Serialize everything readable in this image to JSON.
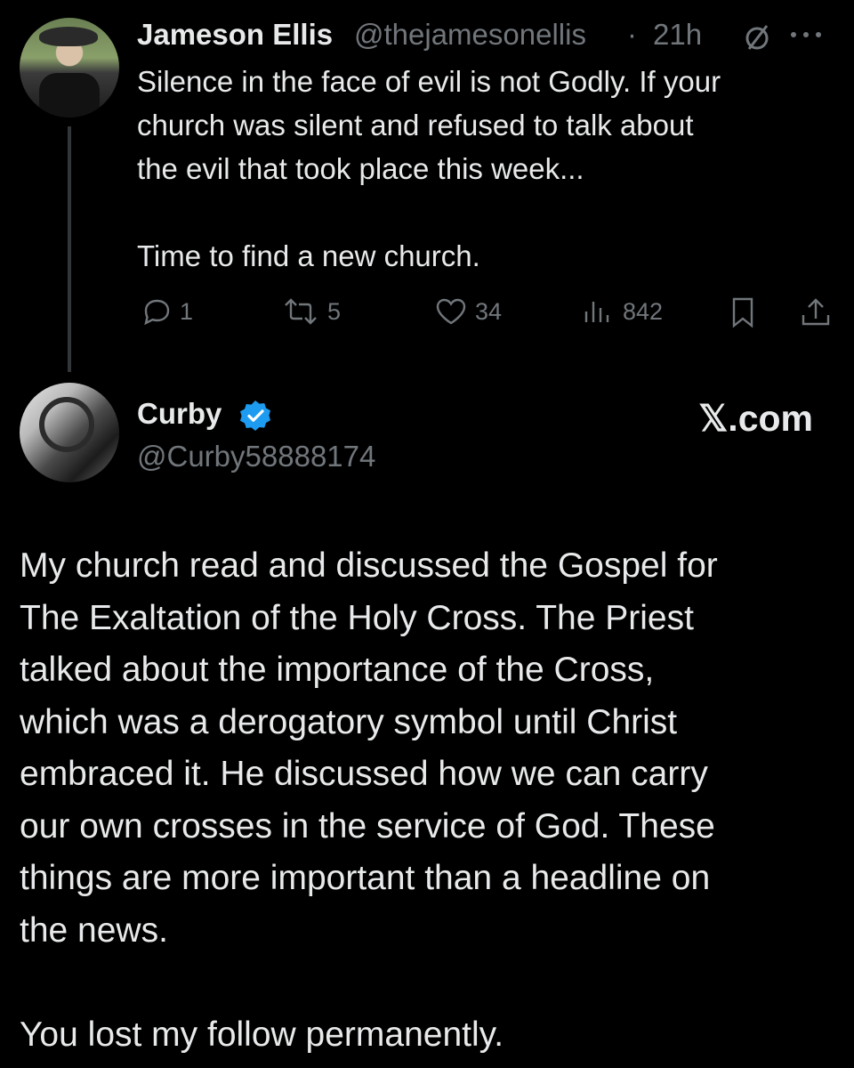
{
  "post1": {
    "name": "Jameson Ellis",
    "handle": "@thejamesonellis",
    "separator": "·",
    "time": "21h",
    "text": "Silence in the face of evil is not Godly. If your\nchurch was silent and refused to talk about\nthe evil that took place this week...\n\nTime to find a new church.",
    "replies": "1",
    "reposts": "5",
    "likes": "34",
    "views": "842"
  },
  "post2": {
    "name": "Curby",
    "handle": "@Curby58888174",
    "verified_color": "#1d9bf0",
    "text": "My church read and discussed the Gospel for\nThe Exaltation of the Holy Cross.  The Priest\ntalked about the importance of the Cross,\nwhich was a derogatory symbol until Christ\nembraced it.  He discussed how we can carry\nour own crosses in the service of God.  These\nthings are more important than a headline on\nthe news.\n\nYou lost my follow permanently."
  },
  "branding": {
    "site": "𝕏.com"
  }
}
